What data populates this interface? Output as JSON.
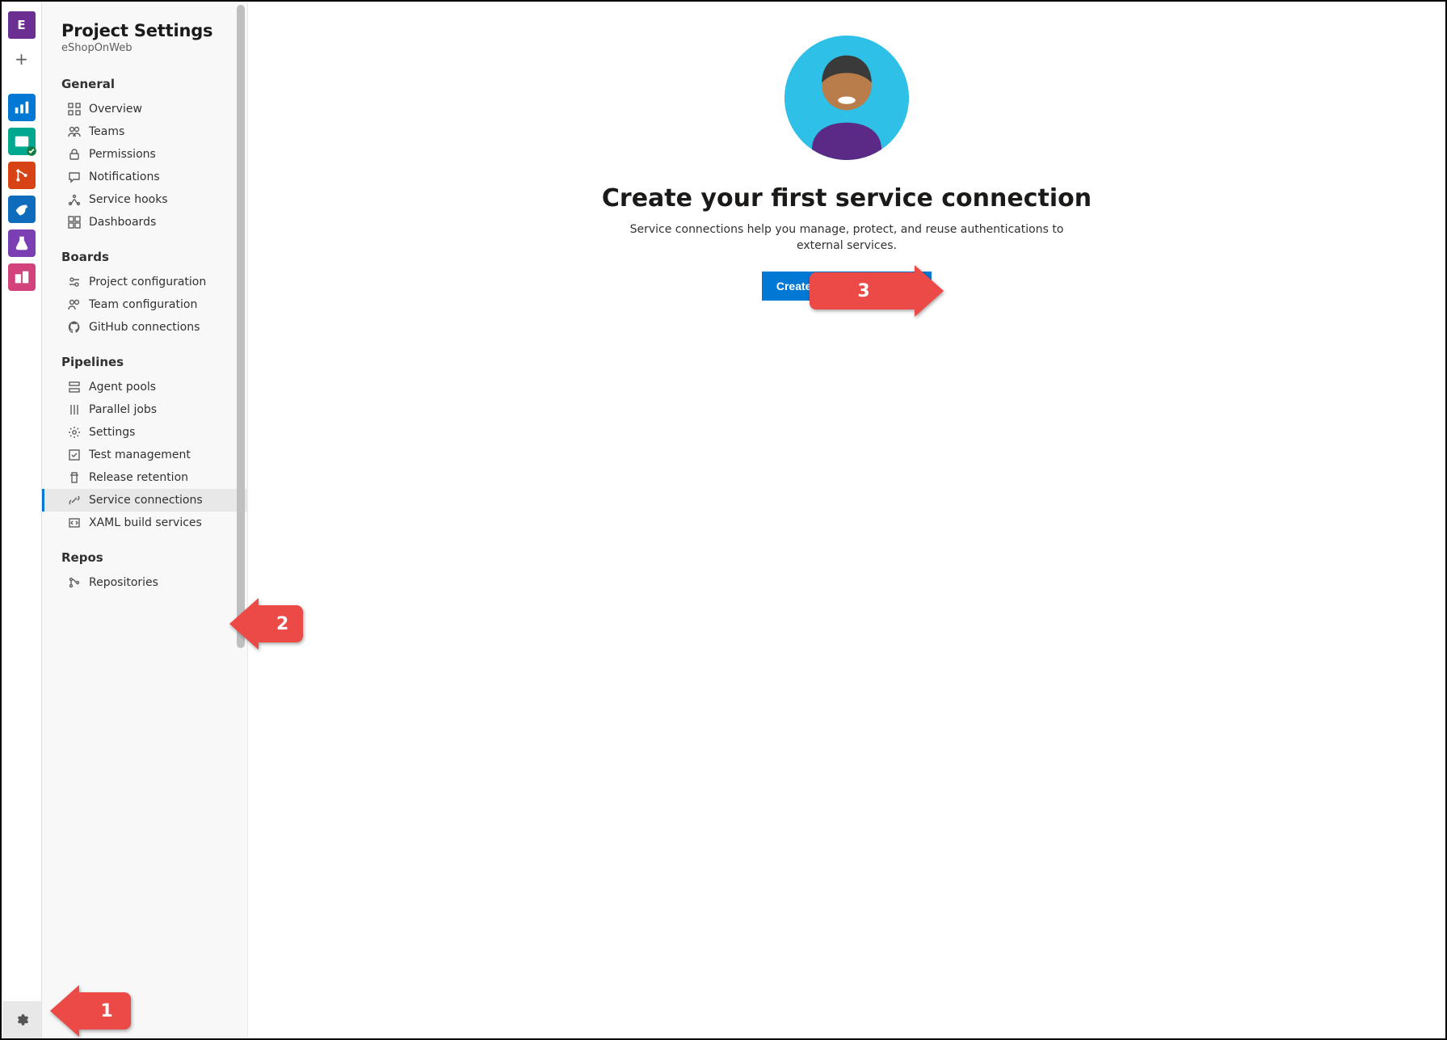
{
  "rail": {
    "project_initial": "E"
  },
  "sidebar": {
    "title": "Project Settings",
    "subtitle": "eShopOnWeb",
    "sections": {
      "general": {
        "title": "General",
        "items": [
          "Overview",
          "Teams",
          "Permissions",
          "Notifications",
          "Service hooks",
          "Dashboards"
        ]
      },
      "boards": {
        "title": "Boards",
        "items": [
          "Project configuration",
          "Team configuration",
          "GitHub connections"
        ]
      },
      "pipelines": {
        "title": "Pipelines",
        "items": [
          "Agent pools",
          "Parallel jobs",
          "Settings",
          "Test management",
          "Release retention",
          "Service connections",
          "XAML build services"
        ]
      },
      "repos": {
        "title": "Repos",
        "items": [
          "Repositories"
        ]
      }
    },
    "active_item": "Service connections"
  },
  "main": {
    "title": "Create your first service connection",
    "description": "Service connections help you manage, protect, and reuse authentications to external services.",
    "button_label": "Create service connection"
  },
  "annotations": {
    "one": "1",
    "two": "2",
    "three": "3"
  }
}
